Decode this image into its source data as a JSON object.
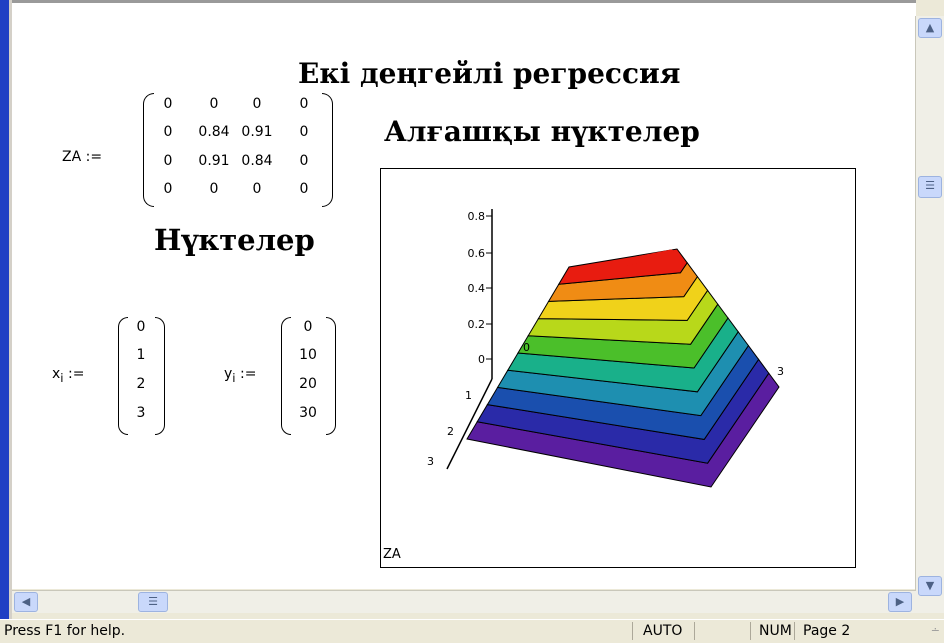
{
  "worksheet": {
    "title_main": "Екі деңгейлі регрессия",
    "title_plot": "Алғашқы нүктелер",
    "title_points": "Нүктелер"
  },
  "matrix_za": {
    "label": "ZA :=",
    "rows": [
      [
        "0",
        "0",
        "0",
        "0"
      ],
      [
        "0",
        "0.84",
        "0.91",
        "0"
      ],
      [
        "0",
        "0.91",
        "0.84",
        "0"
      ],
      [
        "0",
        "0",
        "0",
        "0"
      ]
    ]
  },
  "vector_x": {
    "name": "x",
    "subscript": "i",
    "assign": ":=",
    "values": [
      "0",
      "1",
      "2",
      "3"
    ]
  },
  "vector_y": {
    "name": "y",
    "subscript": "i",
    "assign": ":=",
    "values": [
      "0",
      "10",
      "20",
      "30"
    ]
  },
  "plot": {
    "caption": "ZA",
    "z_ticks": [
      "0.8",
      "0.6",
      "0.4",
      "0.2",
      "0"
    ],
    "left_axis_ticks": [
      "1",
      "2",
      "3"
    ],
    "right_axis_tick": "3",
    "small_zero": "0",
    "band_colors": [
      "#5a1ea0",
      "#2a2aa8",
      "#1a4fae",
      "#1e8fb0",
      "#19b08a",
      "#4bbf2a",
      "#b8d81a",
      "#f0d21a",
      "#f08c14",
      "#e81c10"
    ]
  },
  "statusbar": {
    "help": "Press F1 for help.",
    "mode": "AUTO",
    "num": "NUM",
    "page": "Page 2"
  }
}
